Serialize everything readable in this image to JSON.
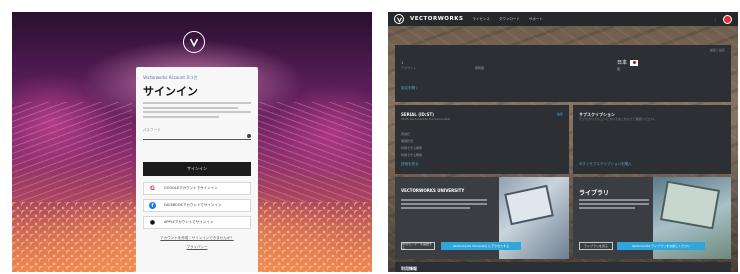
{
  "login": {
    "top_link": "Vectorworks Account 로그인",
    "title": "サインイン",
    "field_label": "パスワード",
    "signin_button": "サインイン",
    "google_button": "GOOGLEアカウントでサインイン",
    "facebook_button": "FACEBOOKアカウントでサインイン",
    "apple_button": "APPLEアカウントでサインイン",
    "footer_links": "アカウントを作成｜サインインできませんか？",
    "privacy_link": "プライバシー",
    "icons": [
      "vectorworks-logo-icon",
      "eye-icon",
      "google-icon",
      "facebook-icon",
      "apple-icon"
    ]
  },
  "dashboard": {
    "brand": "VECTORWORKS",
    "nav": [
      "ライセンス",
      "ダウンロード",
      "サポート"
    ],
    "nav_dots": "⋮",
    "account": {
      "top_right": "編集と設定",
      "id": "1",
      "sub_left": "アカウント",
      "sub_mid": "所有者",
      "country": "日本",
      "country_sub": "国",
      "link": "設定を開く"
    },
    "serial": {
      "title": "SERIAL (ID:ST)",
      "subtitle": "2025 Vectorworks Fundamentals",
      "edit": "編集",
      "rows": [
        "有効日",
        "使用状況",
        "利用できる場所",
        "利用できる時間"
      ],
      "link": "詳細を見る"
    },
    "subscription": {
      "title": "サブスクリプション",
      "subtitle": "サブスクリプションについてはこちらでご確認ください。",
      "link": "今すぐサブスクリプションを購入"
    },
    "university": {
      "title": "VECTORWORKS UNIVERSITY",
      "button1": "学習センターを開始する",
      "button2": "Vectorworks University にアクセスする"
    },
    "library": {
      "title": "ライブラリ",
      "button1": "ライブラリを見る",
      "button2": "Vectorworks ライブラリをお試しください"
    },
    "usage": {
      "title": "利用情報"
    },
    "colors": {
      "accent": "#2fa6d9",
      "panel": "#2c3034",
      "nav": "#26292c"
    }
  }
}
